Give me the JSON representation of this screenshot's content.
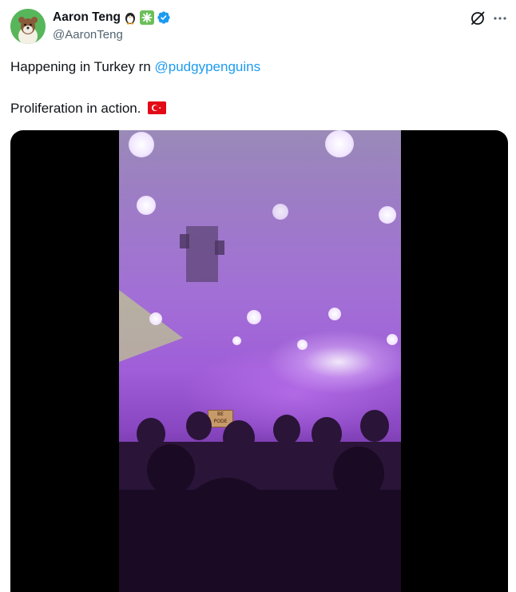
{
  "author": {
    "display_name": "Aaron Teng",
    "handle": "@AaronTeng",
    "name_emojis": [
      "penguin-emoji",
      "clover-emoji"
    ],
    "verified": true
  },
  "colors": {
    "link": "#1d9bf0",
    "verified": "#1d9bf0",
    "secondary_text": "#536471",
    "media_bg": "#000000"
  },
  "tweet": {
    "line1_text": "Happening in Turkey rn ",
    "line1_mention": "@pudgypenguins",
    "line2_text": "Proliferation in action.",
    "line2_flag": "turkey-flag-emoji"
  },
  "actions": {
    "grok_icon": "grok-icon",
    "more_icon": "more-icon"
  },
  "media": {
    "type": "video",
    "sign_top": "BE",
    "sign_bottom": "PODE"
  }
}
